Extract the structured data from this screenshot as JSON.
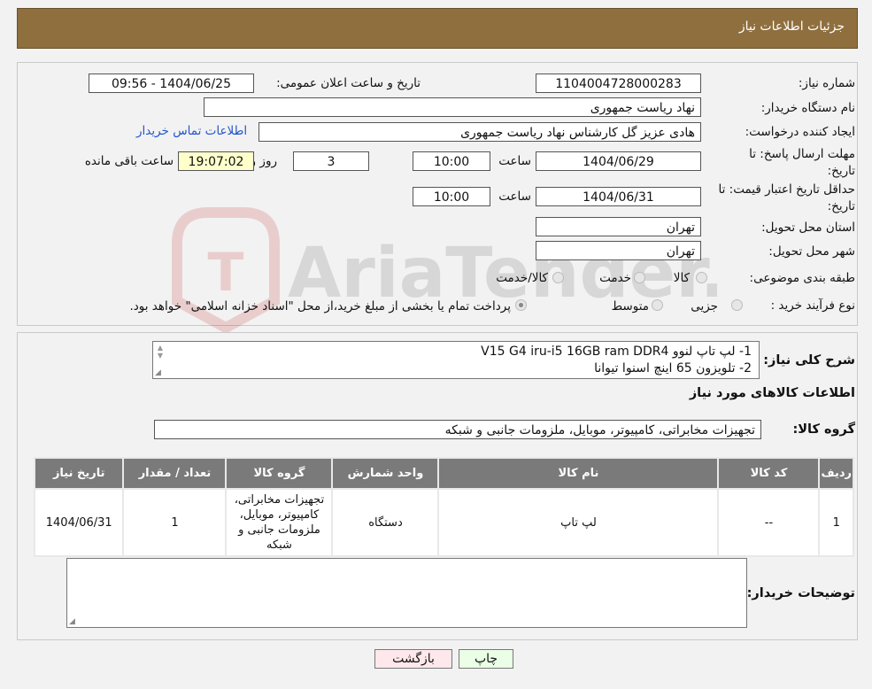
{
  "header": {
    "title": "جزئیات اطلاعات نیاز"
  },
  "details": {
    "need_number_label": "شماره نیاز:",
    "need_number": "1104004728000283",
    "announce_label": "تاریخ و ساعت اعلان عمومی:",
    "announce_value": "1404/06/25 - 09:56",
    "buyer_org_label": "نام دستگاه خریدار:",
    "buyer_org": "نهاد ریاست جمهوری",
    "creator_label": "ایجاد کننده درخواست:",
    "creator": "هادی عزیز گل کارشناس نهاد ریاست جمهوری",
    "contact_link": "اطلاعات تماس خریدار",
    "deadline_label_1": "مهلت ارسال پاسخ: تا",
    "deadline_label_2": "تاریخ:",
    "deadline_date": "1404/06/29",
    "time_label": "ساعت",
    "deadline_time": "10:00",
    "days_value": "3",
    "days_label": "روز و",
    "remaining_time": "19:07:02",
    "remaining_label": "ساعت باقی مانده",
    "validity_label_1": "حداقل تاریخ اعتبار قیمت: تا",
    "validity_label_2": "تاریخ:",
    "validity_date": "1404/06/31",
    "validity_time": "10:00",
    "province_label": "استان محل تحویل:",
    "province": "تهران",
    "city_label": "شهر محل تحویل:",
    "city": "تهران",
    "category_label": "طبقه بندی موضوعی:",
    "category_options": [
      "کالا",
      "خدمت",
      "کالا/خدمت"
    ],
    "process_label": "نوع فرآیند خرید :",
    "process_options": [
      "جزیی",
      "متوسط"
    ],
    "process_note": "پرداخت تمام یا بخشی از مبلغ خرید،از محل \"اسناد خزانه اسلامی\" خواهد بود."
  },
  "summary": {
    "label": "شرح کلی نیاز:",
    "line1": "1- لپ تاپ لنوو V15 G4 iru-i5 16GB ram DDR4",
    "line2": "2- تلویزون 65 اینچ اسنوا تیوانا"
  },
  "goods": {
    "section_title": "اطلاعات کالاهای مورد نیاز",
    "group_label": "گروه کالا:",
    "group_value": "تجهیزات مخابراتی، کامپیوتر، موبایل، ملزومات جانبی و شبکه",
    "columns": [
      "ردیف",
      "کد کالا",
      "نام کالا",
      "واحد شمارش",
      "گروه کالا",
      "تعداد / مقدار",
      "تاریخ نیاز"
    ],
    "rows": [
      [
        "1",
        "--",
        "لپ تاپ",
        "دستگاه",
        "تجهیزات مخابراتی، کامپیوتر، موبایل، ملزومات جانبی و شبکه",
        "1",
        "1404/06/31"
      ]
    ]
  },
  "buyer_notes": {
    "label": "توضیحات خریدار:",
    "value": ""
  },
  "buttons": {
    "print": "چاپ",
    "back": "بازگشت"
  },
  "watermark": {
    "text": "AriaTender.neT"
  }
}
